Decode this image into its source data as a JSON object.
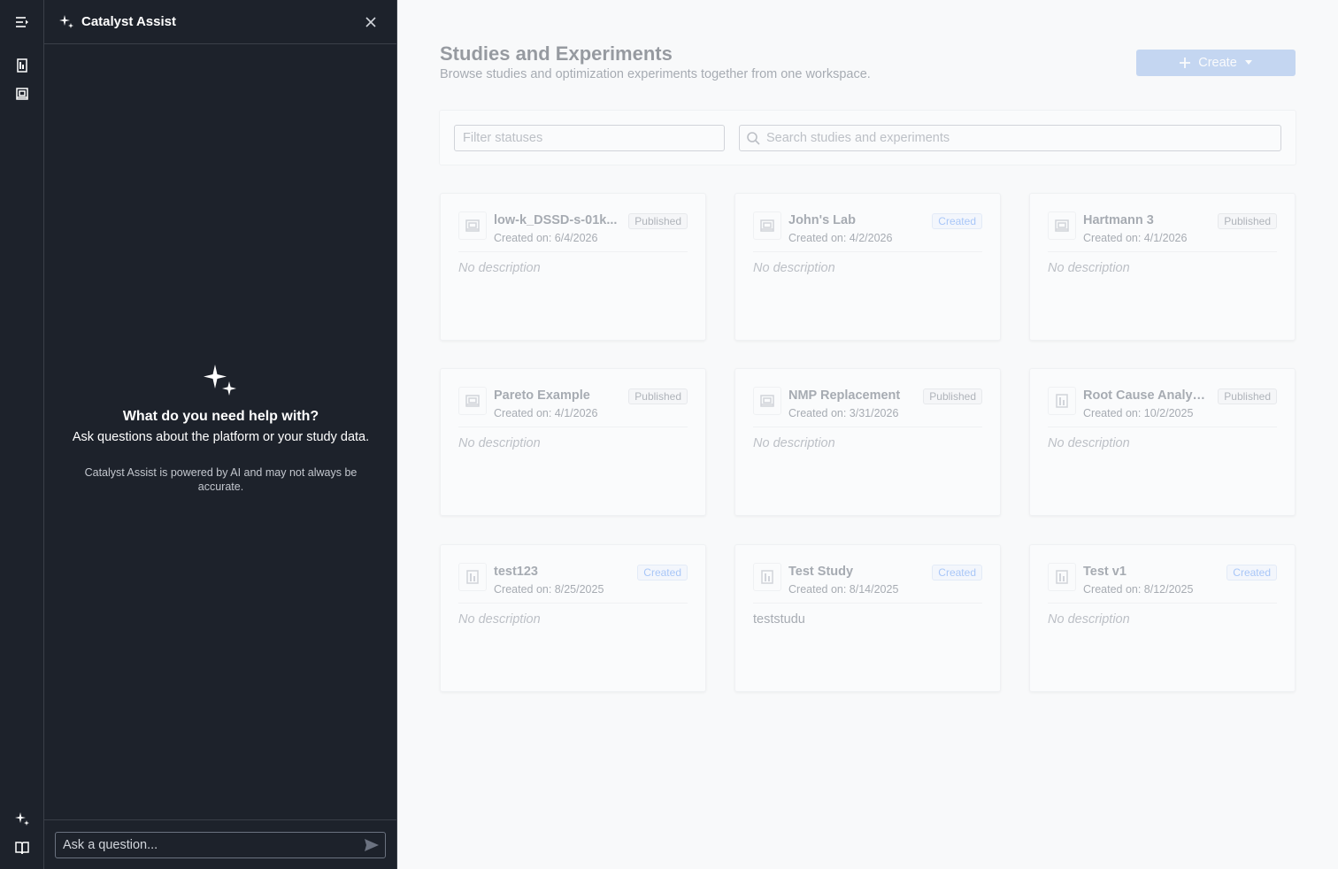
{
  "assist": {
    "title": "Catalyst Assist",
    "empty_title": "What do you need help with?",
    "empty_subtitle": "Ask questions about the platform or your study data.",
    "disclaimer": "Catalyst Assist is powered by AI and may not always be accurate.",
    "input_placeholder": "Ask a question..."
  },
  "rail": {
    "icons": [
      "menu-expand-icon",
      "study-icon",
      "experiment-icon",
      "sparkle-icon",
      "book-icon"
    ]
  },
  "main": {
    "title": "Studies and Experiments",
    "subtitle": "Browse studies and optimization experiments together from one workspace.",
    "create_label": "Create",
    "filter_placeholder": "Filter statuses",
    "search_placeholder": "Search studies and experiments",
    "cards": [
      {
        "name": "low-k_DSSD-s-01k...",
        "date": "Created on: 6/4/2026",
        "status": "Published",
        "description": "No description",
        "kind": "experiment"
      },
      {
        "name": "John's Lab",
        "date": "Created on: 4/2/2026",
        "status": "Created",
        "description": "No description",
        "kind": "experiment"
      },
      {
        "name": "Hartmann 3",
        "date": "Created on: 4/1/2026",
        "status": "Published",
        "description": "No description",
        "kind": "experiment"
      },
      {
        "name": "Pareto Example",
        "date": "Created on: 4/1/2026",
        "status": "Published",
        "description": "No description",
        "kind": "experiment"
      },
      {
        "name": "NMP Replacement",
        "date": "Created on: 3/31/2026",
        "status": "Published",
        "description": "No description",
        "kind": "experiment"
      },
      {
        "name": "Root Cause Analysi...",
        "date": "Created on: 10/2/2025",
        "status": "Published",
        "description": "No description",
        "kind": "study"
      },
      {
        "name": "test123",
        "date": "Created on: 8/25/2025",
        "status": "Created",
        "description": "No description",
        "kind": "study"
      },
      {
        "name": "Test Study",
        "date": "Created on: 8/14/2025",
        "status": "Created",
        "description": "teststudu",
        "kind": "study"
      },
      {
        "name": "Test v1",
        "date": "Created on: 8/12/2025",
        "status": "Created",
        "description": "No description",
        "kind": "study"
      }
    ]
  },
  "colors": {
    "panel_bg": "#1d222b",
    "accent": "#7fa7e6",
    "created_badge": "#3b82f6"
  }
}
